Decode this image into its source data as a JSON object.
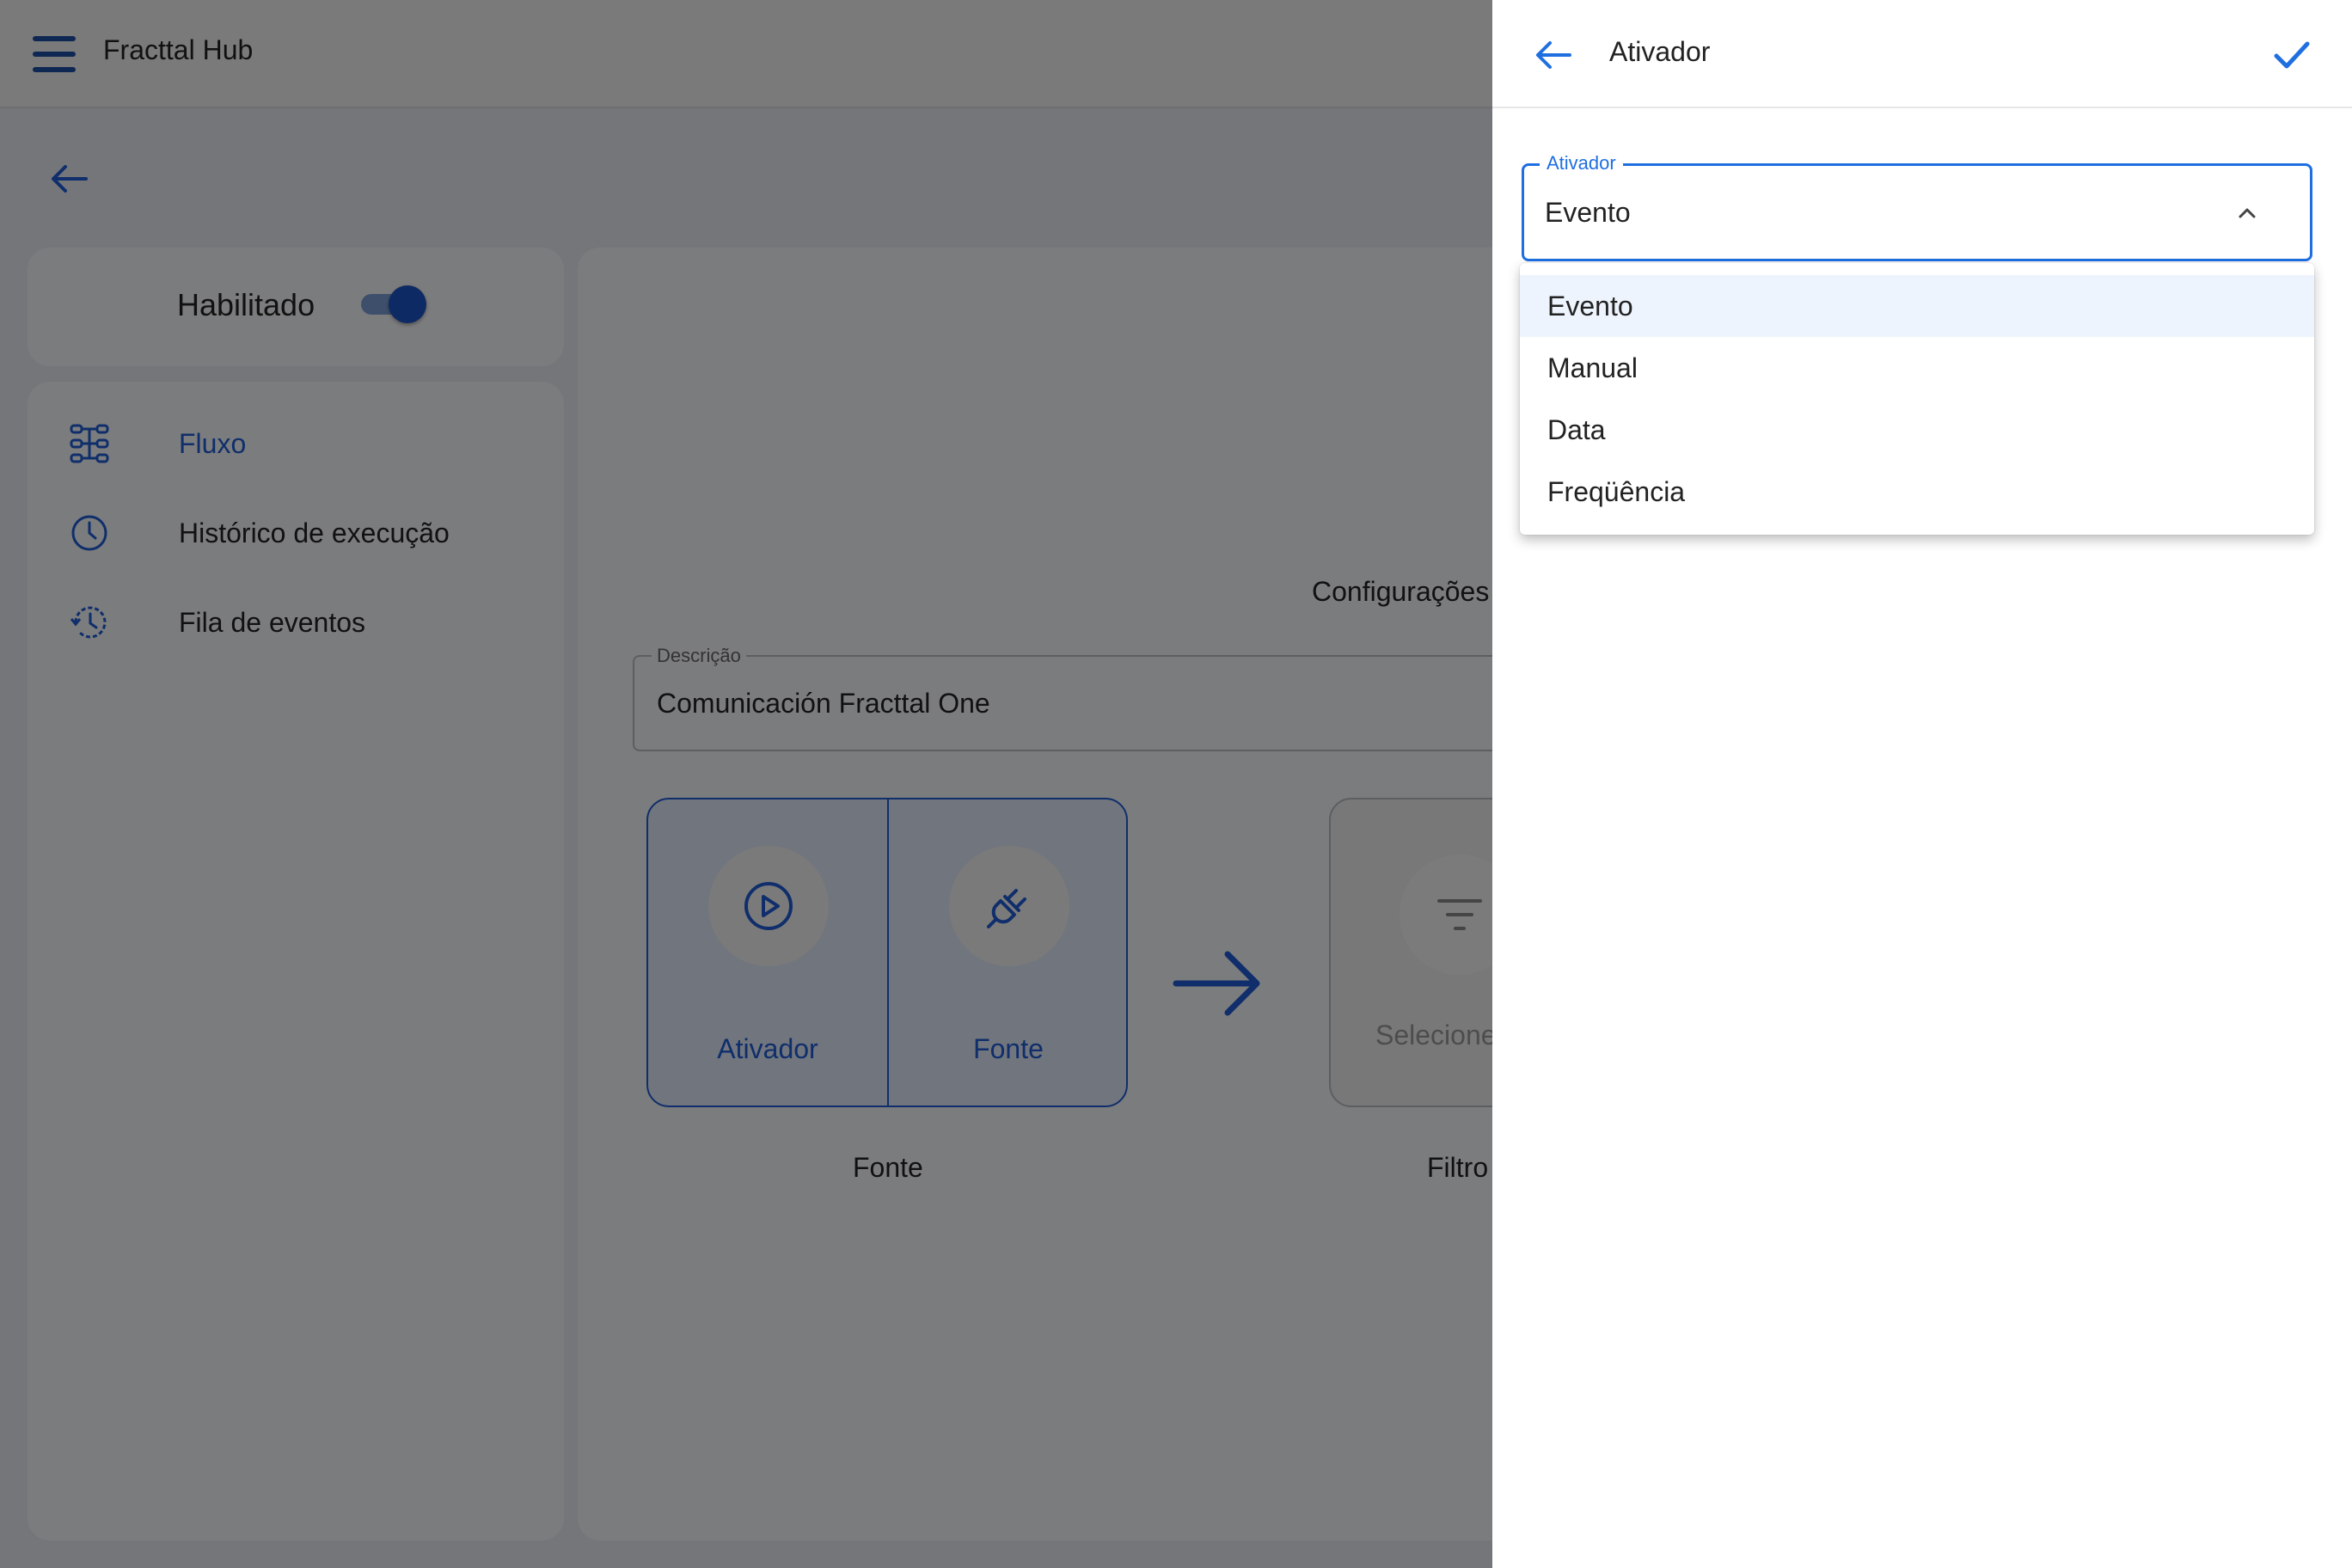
{
  "app": {
    "title": "Fracttal Hub"
  },
  "toggle": {
    "label": "Habilitado",
    "enabled": true
  },
  "nav": {
    "items": [
      {
        "label": "Fluxo",
        "icon": "flow-icon",
        "active": true
      },
      {
        "label": "Histórico de execução",
        "icon": "clock-icon",
        "active": false
      },
      {
        "label": "Fila de eventos",
        "icon": "history-icon",
        "active": false
      }
    ]
  },
  "main": {
    "config_title": "Configurações",
    "description": {
      "label": "Descrição",
      "value": "Comunicación Fracttal One"
    },
    "source": {
      "trigger_label": "Ativador",
      "source_label": "Fonte",
      "caption": "Fonte"
    },
    "filter": {
      "placeholder": "Selecione",
      "caption": "Filtro"
    }
  },
  "panel": {
    "title": "Ativador",
    "select": {
      "label": "Ativador",
      "value": "Evento",
      "options": [
        "Evento",
        "Manual",
        "Data",
        "Freqüência"
      ],
      "selected_index": 0
    }
  },
  "colors": {
    "accent": "#1f6fe0",
    "primary": "#1f5cd6"
  }
}
